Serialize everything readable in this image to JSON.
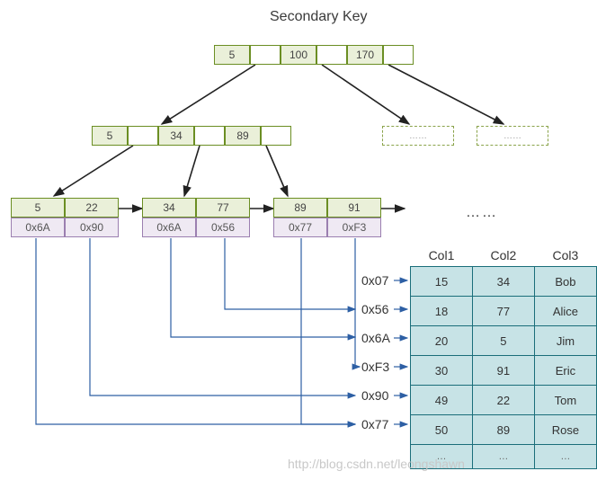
{
  "title": "Secondary Key",
  "root": {
    "keys": [
      "5",
      "100",
      "170"
    ]
  },
  "level2": {
    "keys": [
      "5",
      "34",
      "89"
    ]
  },
  "ghosts": [
    "……",
    "……"
  ],
  "leaves": [
    {
      "keys": [
        "5",
        "22"
      ],
      "ptrs": [
        "0x6A",
        "0x90"
      ]
    },
    {
      "keys": [
        "34",
        "77"
      ],
      "ptrs": [
        "0x6A",
        "0x56"
      ]
    },
    {
      "keys": [
        "89",
        "91"
      ],
      "ptrs": [
        "0x77",
        "0xF3"
      ]
    }
  ],
  "leaf_dots": "……",
  "addresses": [
    "0x07",
    "0x56",
    "0x6A",
    "0xF3",
    "0x90",
    "0x77"
  ],
  "table": {
    "headers": [
      "Col1",
      "Col2",
      "Col3"
    ],
    "rows": [
      [
        "15",
        "34",
        "Bob"
      ],
      [
        "18",
        "77",
        "Alice"
      ],
      [
        "20",
        "5",
        "Jim"
      ],
      [
        "30",
        "91",
        "Eric"
      ],
      [
        "49",
        "22",
        "Tom"
      ],
      [
        "50",
        "89",
        "Rose"
      ],
      [
        "…",
        "…",
        "…"
      ]
    ]
  },
  "watermark": "http://blog.csdn.net/leongshawn",
  "chart_data": {
    "type": "diagram",
    "structure": "B+Tree secondary index",
    "root_keys": [
      5,
      100,
      170
    ],
    "internal_keys": [
      5,
      34,
      89
    ],
    "leaf_entries": [
      {
        "key": 5,
        "ptr": "0x6A"
      },
      {
        "key": 22,
        "ptr": "0x90"
      },
      {
        "key": 34,
        "ptr": "0x6A"
      },
      {
        "key": 77,
        "ptr": "0x56"
      },
      {
        "key": 89,
        "ptr": "0x77"
      },
      {
        "key": 91,
        "ptr": "0xF3"
      }
    ],
    "heap_addresses": [
      "0x07",
      "0x56",
      "0x6A",
      "0xF3",
      "0x90",
      "0x77"
    ],
    "table_columns": [
      "Col1",
      "Col2",
      "Col3"
    ],
    "table_rows": [
      [
        15,
        34,
        "Bob"
      ],
      [
        18,
        77,
        "Alice"
      ],
      [
        20,
        5,
        "Jim"
      ],
      [
        30,
        91,
        "Eric"
      ],
      [
        49,
        22,
        "Tom"
      ],
      [
        50,
        89,
        "Rose"
      ]
    ]
  }
}
